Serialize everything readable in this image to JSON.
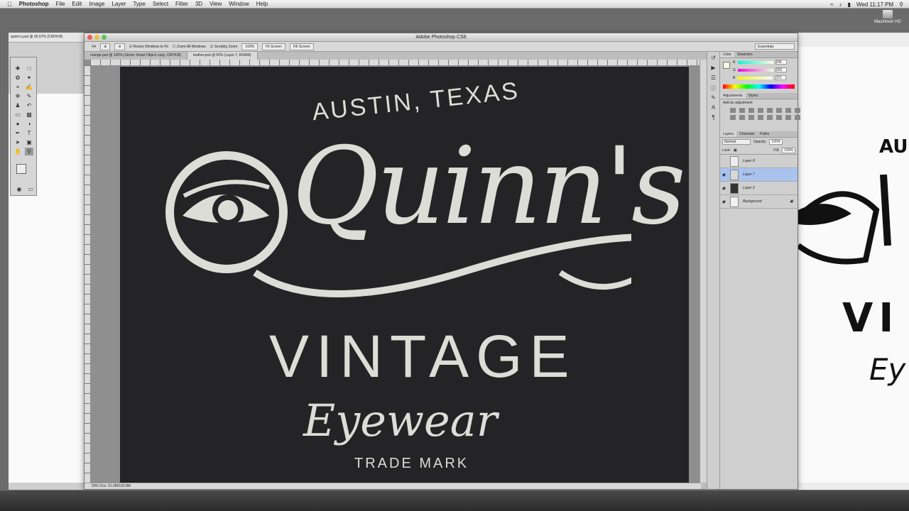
{
  "menubar": {
    "app_name": "Photoshop",
    "items": [
      "File",
      "Edit",
      "Image",
      "Layer",
      "Type",
      "Select",
      "Filter",
      "3D",
      "View",
      "Window",
      "Help"
    ],
    "clock": "Wed 11:17 PM"
  },
  "desktop": {
    "drive_label": "Macintosh HD"
  },
  "window": {
    "title": "Adobe Photoshop CS6",
    "options": {
      "resize_windows": "Resize Windows to Fit",
      "zoom_all": "Zoom All Windows",
      "scrubby_zoom": "Scrubby Zoom",
      "zoom_value": "100%",
      "fit_screen": "Fit Screen",
      "fill_screen": "Fill Screen",
      "workspace": "Essentials"
    },
    "tabs": [
      {
        "label": "orange.psd @ 100% (Vector Smart Object copy, CMYK/8)"
      },
      {
        "label": "leather.psd @ 50% (Layer 7, RGB/8)"
      }
    ],
    "status": "50%    Doc: 51.0M/103.8M"
  },
  "artwork": {
    "city": "AUSTIN, TEXAS",
    "brand": "Quinn's",
    "line1": "VINTAGE",
    "line2": "Eyewear",
    "trademark": "TRADE MARK",
    "bg_color": "#242325",
    "ink_color": "#dcddd6"
  },
  "left_doc": {
    "tab": "quinn's.psd @ 66.67% (CMYK/8)"
  },
  "right_doc": {
    "text_au": "AU",
    "text_vi": "VI",
    "text_ey": "Ey"
  },
  "panels": {
    "color_tabs": [
      "Color",
      "Swatches"
    ],
    "rgb": [
      {
        "label": "R",
        "value": "245"
      },
      {
        "label": "G",
        "value": "250"
      },
      {
        "label": "B",
        "value": "221"
      }
    ],
    "adjust_tabs": [
      "Adjustments",
      "Styles"
    ],
    "adjust_title": "Add an adjustment",
    "layer_tabs": [
      "Layers",
      "Channels",
      "Paths"
    ],
    "blend_mode": "Normal",
    "opacity_label": "Opacity:",
    "opacity_value": "100%",
    "lock_label": "Lock:",
    "fill_label": "Fill:",
    "fill_value": "100%",
    "layers": [
      {
        "name": "Layer 8",
        "visible": false,
        "selected": false,
        "thumb": "#eeeeee"
      },
      {
        "name": "Layer 7",
        "visible": true,
        "selected": true,
        "thumb": "#d8d8d8"
      },
      {
        "name": "Layer 2",
        "visible": true,
        "selected": false,
        "thumb": "#333333"
      },
      {
        "name": "Background",
        "visible": true,
        "selected": false,
        "thumb": "#f2f2f2"
      }
    ]
  }
}
